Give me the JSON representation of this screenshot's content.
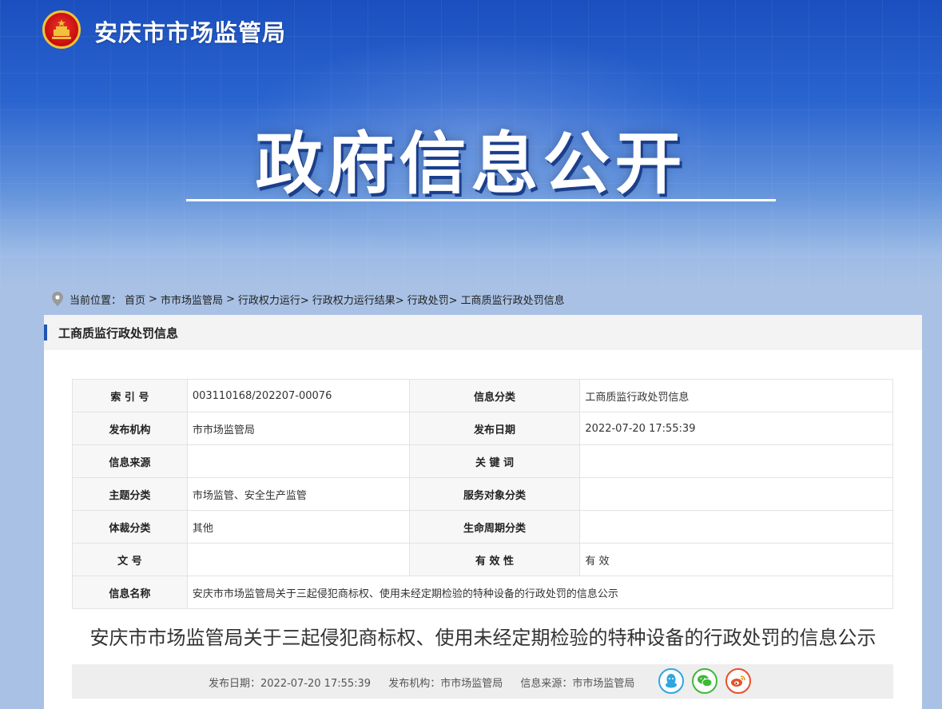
{
  "header": {
    "site_title": "安庆市市场监管局",
    "banner_title": "政府信息公开"
  },
  "breadcrumb": {
    "prefix": "当前位置：",
    "items": [
      "首页",
      ">",
      "市市场监管局",
      ">",
      "行政权力运行>",
      "行政权力运行结果>",
      "行政处罚>",
      "工商质监行政处罚信息"
    ]
  },
  "panel": {
    "heading": "工商质监行政处罚信息"
  },
  "info_table": {
    "rows": [
      {
        "k1": "索 引 号",
        "v1": "003110168/202207-00076",
        "k2": "信息分类",
        "v2": "工商质监行政处罚信息"
      },
      {
        "k1": "发布机构",
        "v1": "市市场监管局",
        "k2": "发布日期",
        "v2": "2022-07-20 17:55:39"
      },
      {
        "k1": "信息来源",
        "v1": "",
        "k2": "关 键 词",
        "v2": ""
      },
      {
        "k1": "主题分类",
        "v1": "市场监管、安全生产监管",
        "k2": "服务对象分类",
        "v2": ""
      },
      {
        "k1": "体裁分类",
        "v1": "其他",
        "k2": "生命周期分类",
        "v2": ""
      },
      {
        "k1": "文 号",
        "v1": "",
        "k2": "有 效 性",
        "v2": "有 效"
      }
    ],
    "name_row": {
      "k": "信息名称",
      "v": "安庆市市场监管局关于三起侵犯商标权、使用未经定期检验的特种设备的行政处罚的信息公示"
    }
  },
  "document": {
    "title": "安庆市市场监管局关于三起侵犯商标权、使用未经定期检验的特种设备的行政处罚的信息公示",
    "meta_date": "发布日期：2022-07-20 17:55:39",
    "meta_org": "发布机构：市市场监管局",
    "meta_source": "信息来源：市市场监管局"
  },
  "share": {
    "qq_color": "#2ea7e0",
    "wechat_color": "#3fb836",
    "weibo_color": "#e6502a"
  },
  "colors": {
    "brand_blue": "#1f56b5",
    "hero_blue": "#1b4fbf"
  }
}
